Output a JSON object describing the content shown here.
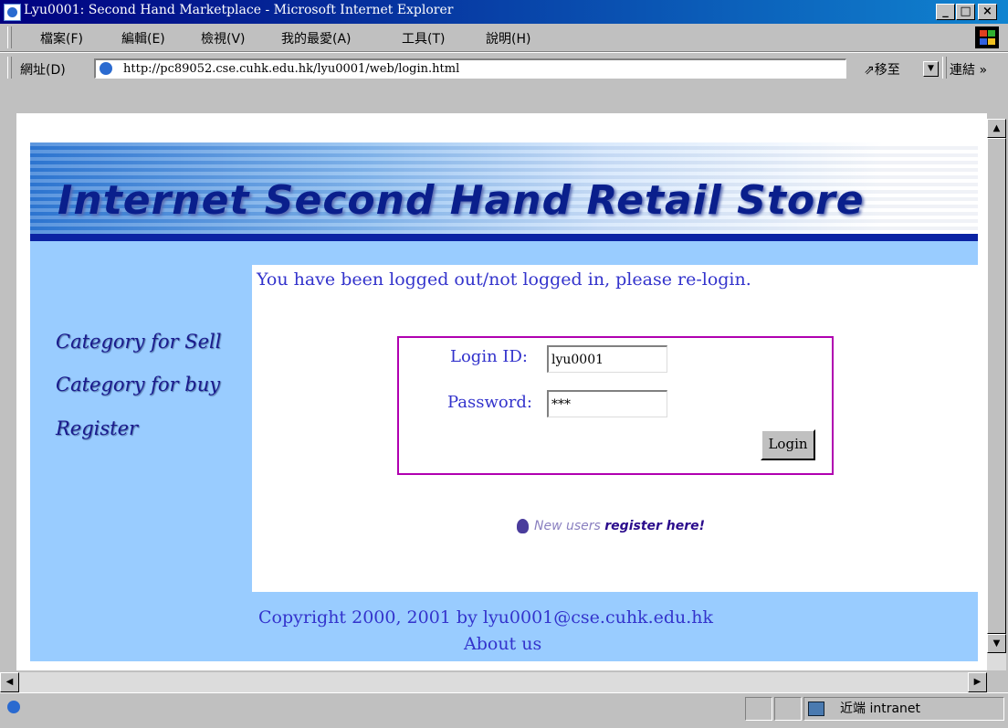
{
  "window": {
    "title": "Lyu0001: Second Hand Marketplace - Microsoft Internet Explorer",
    "minimize": "_",
    "maximize": "□",
    "close": "×"
  },
  "menu": {
    "items": [
      "檔案(F)",
      "編輯(E)",
      "檢視(V)",
      "我的最愛(A)",
      "工具(T)",
      "說明(H)"
    ]
  },
  "address": {
    "label": "網址(D)",
    "url": "http://pc89052.cse.cuhk.edu.hk/lyu0001/web/login.html",
    "go": "⇗移至",
    "links": "連結 »"
  },
  "page": {
    "banner_title": "Internet Second Hand Retail Store",
    "message": "You have been logged out/not logged in, please re-login.",
    "nav": [
      "Category for Sell",
      "Category for buy",
      "Register"
    ],
    "login": {
      "id_label": "Login ID:",
      "id_value": "lyu0001",
      "password_label": "Password:",
      "password_value": "***",
      "button": "Login"
    },
    "new_users": "New users",
    "register_here": "register here!",
    "footer_copyright": "Copyright 2000, 2001 by lyu0001@cse.cuhk.edu.hk",
    "footer_about": "About us"
  },
  "status": {
    "zone": "近端 intranet"
  },
  "icons": [
    "ie-app-icon",
    "windows-logo-icon",
    "ie-page-icon",
    "dropdown-arrow-icon",
    "scroll-up-icon",
    "scroll-down-icon",
    "scroll-left-icon",
    "scroll-right-icon",
    "bulb-icon",
    "intranet-icon"
  ]
}
